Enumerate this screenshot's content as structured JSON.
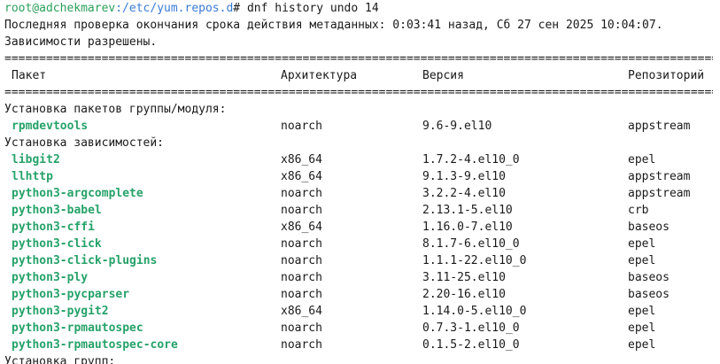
{
  "terminal": {
    "prompt_user_host": "root@adchekmarev",
    "prompt_path": ":/etc/yum.repos.d",
    "prompt_command": "# dnf history undo 14",
    "metadata_line": "Последняя проверка окончания срока действия метаданных: 0:03:41 назад, Сб 27 сен 2025 10:04:07.",
    "deps_resolved": "Зависимости разрешены.",
    "separator": "================================================================================================================================================================",
    "table_header": {
      "package": "Пакет",
      "arch": "Архитектура",
      "version": "Версия",
      "repo": "Репозиторий"
    },
    "section_group_install": "Установка пакетов группы/модуля:",
    "group_packages": [
      {
        "name": "rpmdevtools",
        "arch": "noarch",
        "version": "9.6-9.el10",
        "repo": "appstream"
      }
    ],
    "section_deps_install": "Установка зависимостей:",
    "dep_packages": [
      {
        "name": "libgit2",
        "arch": "x86_64",
        "version": "1.7.2-4.el10_0",
        "repo": "epel"
      },
      {
        "name": "llhttp",
        "arch": "x86_64",
        "version": "9.1.3-9.el10",
        "repo": "appstream"
      },
      {
        "name": "python3-argcomplete",
        "arch": "noarch",
        "version": "3.2.2-4.el10",
        "repo": "appstream"
      },
      {
        "name": "python3-babel",
        "arch": "noarch",
        "version": "2.13.1-5.el10",
        "repo": "crb"
      },
      {
        "name": "python3-cffi",
        "arch": "x86_64",
        "version": "1.16.0-7.el10",
        "repo": "baseos"
      },
      {
        "name": "python3-click",
        "arch": "noarch",
        "version": "8.1.7-6.el10_0",
        "repo": "epel"
      },
      {
        "name": "python3-click-plugins",
        "arch": "noarch",
        "version": "1.1.1-22.el10_0",
        "repo": "epel"
      },
      {
        "name": "python3-ply",
        "arch": "noarch",
        "version": "3.11-25.el10",
        "repo": "baseos"
      },
      {
        "name": "python3-pycparser",
        "arch": "noarch",
        "version": "2.20-16.el10",
        "repo": "baseos"
      },
      {
        "name": "python3-pygit2",
        "arch": "x86_64",
        "version": "1.14.0-5.el10_0",
        "repo": "epel"
      },
      {
        "name": "python3-rpmautospec",
        "arch": "noarch",
        "version": "0.7.3-1.el10_0",
        "repo": "epel"
      },
      {
        "name": "python3-rpmautospec-core",
        "arch": "noarch",
        "version": "0.1.5-2.el10_0",
        "repo": "epel"
      }
    ],
    "next_section_partial": "Установка групп:",
    "colors": {
      "background": "#ffffff",
      "text": "#1a1a1a",
      "prompt_user": "#2aa05a",
      "prompt_path": "#3a7bd5",
      "package_name": "#26a269"
    }
  }
}
